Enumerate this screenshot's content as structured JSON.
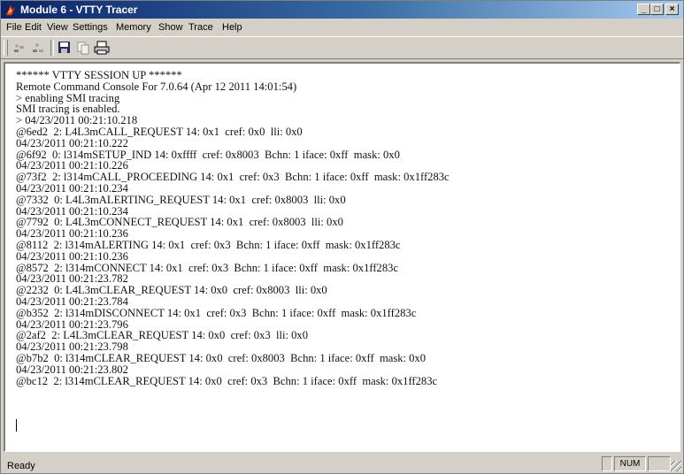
{
  "window": {
    "title": "Module 6 - VTTY Tracer",
    "controls": {
      "minimize": "_",
      "maximize": "□",
      "close": "×"
    }
  },
  "menu": {
    "items": [
      "File",
      "Edit",
      "View",
      "Settings",
      "Memory",
      "Show",
      "Trace",
      "Help"
    ]
  },
  "toolbar": {
    "buttons": [
      "connect-icon",
      "disconnect-icon",
      "save-icon",
      "copy-icon",
      "print-icon"
    ]
  },
  "console": {
    "lines": [
      "****** VTTY SESSION UP ******",
      "Remote Command Console For 7.0.64 (Apr 12 2011 14:01:54)",
      "> enabling SMI tracing",
      "SMI tracing is enabled.",
      "> 04/23/2011 00:21:10.218",
      "@6ed2  2: L4L3mCALL_REQUEST 14: 0x1  cref: 0x0  lli: 0x0",
      "04/23/2011 00:21:10.222",
      "@6f92  0: l314mSETUP_IND 14: 0xffff  cref: 0x8003  Bchn: 1 iface: 0xff  mask: 0x0",
      "04/23/2011 00:21:10.226",
      "@73f2  2: l314mCALL_PROCEEDING 14: 0x1  cref: 0x3  Bchn: 1 iface: 0xff  mask: 0x1ff283c",
      "04/23/2011 00:21:10.234",
      "@7332  0: L4L3mALERTING_REQUEST 14: 0x1  cref: 0x8003  lli: 0x0",
      "04/23/2011 00:21:10.234",
      "@7792  0: L4L3mCONNECT_REQUEST 14: 0x1  cref: 0x8003  lli: 0x0",
      "04/23/2011 00:21:10.236",
      "@8112  2: l314mALERTING 14: 0x1  cref: 0x3  Bchn: 1 iface: 0xff  mask: 0x1ff283c",
      "04/23/2011 00:21:10.236",
      "@8572  2: l314mCONNECT 14: 0x1  cref: 0x3  Bchn: 1 iface: 0xff  mask: 0x1ff283c",
      "04/23/2011 00:21:23.782",
      "@2232  0: L4L3mCLEAR_REQUEST 14: 0x0  cref: 0x8003  lli: 0x0",
      "04/23/2011 00:21:23.784",
      "@b352  2: l314mDISCONNECT 14: 0x1  cref: 0x3  Bchn: 1 iface: 0xff  mask: 0x1ff283c",
      "04/23/2011 00:21:23.796",
      "@2af2  2: L4L3mCLEAR_REQUEST 14: 0x0  cref: 0x3  lli: 0x0",
      "04/23/2011 00:21:23.798",
      "@b7b2  0: l314mCLEAR_REQUEST 14: 0x0  cref: 0x8003  Bchn: 1 iface: 0xff  mask: 0x0",
      "04/23/2011 00:21:23.802",
      "@bc12  2: l314mCLEAR_REQUEST 14: 0x0  cref: 0x3  Bchn: 1 iface: 0xff  mask: 0x1ff283c"
    ]
  },
  "status": {
    "text": "Ready",
    "panes": [
      "",
      "NUM",
      ""
    ]
  },
  "colors": {
    "title_start": "#0a246a",
    "title_end": "#a6caf0",
    "chrome": "#d4d0c8",
    "console_bg": "#ffffff"
  }
}
